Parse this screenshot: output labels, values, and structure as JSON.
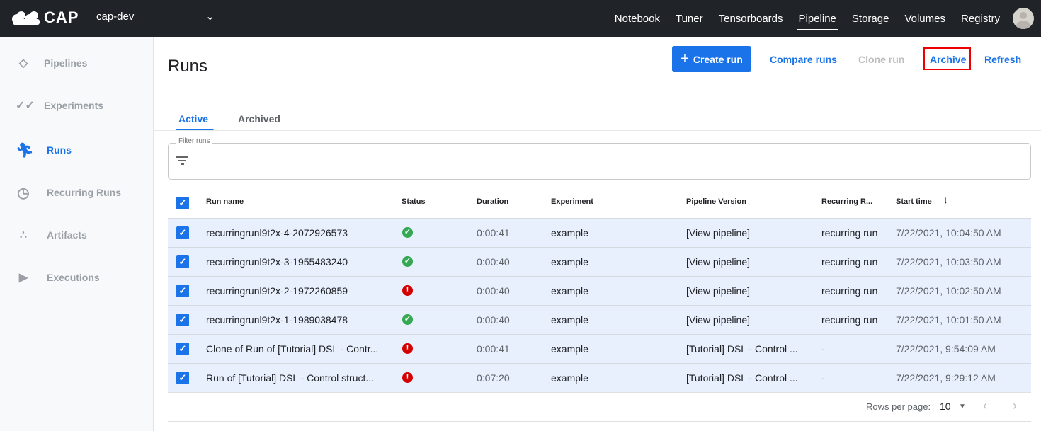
{
  "topbar": {
    "brand": "CAP",
    "namespace": "cap-dev",
    "nav": [
      "Notebook",
      "Tuner",
      "Tensorboards",
      "Pipeline",
      "Storage",
      "Volumes",
      "Registry"
    ],
    "active_nav": "Pipeline"
  },
  "sidebar": {
    "items": [
      {
        "label": "Pipelines",
        "icon": "pipelines-icon"
      },
      {
        "label": "Experiments",
        "icon": "experiments-icon"
      },
      {
        "label": "Runs",
        "icon": "runs-icon",
        "active": true
      },
      {
        "label": "Recurring Runs",
        "icon": "alarm-icon"
      },
      {
        "label": "Artifacts",
        "icon": "artifacts-icon"
      },
      {
        "label": "Executions",
        "icon": "play-icon"
      }
    ]
  },
  "page": {
    "title": "Runs",
    "create_run": "Create run",
    "compare_runs": "Compare runs",
    "clone_run": "Clone run",
    "archive": "Archive",
    "refresh": "Refresh"
  },
  "tabs": {
    "active": "Active",
    "archived": "Archived"
  },
  "filter": {
    "label": "Filter runs"
  },
  "table": {
    "headers": {
      "run_name": "Run name",
      "status": "Status",
      "duration": "Duration",
      "experiment": "Experiment",
      "pipeline_version": "Pipeline Version",
      "recurring_run": "Recurring R...",
      "start_time": "Start time"
    },
    "sort_indicator": "↓",
    "rows": [
      {
        "name": "recurringrunl9t2x-4-2072926573",
        "status": "success",
        "duration": "0:00:41",
        "experiment": "example",
        "pipeline": "[View pipeline]",
        "recurring": "recurring run",
        "start": "7/22/2021, 10:04:50 AM",
        "checked": true
      },
      {
        "name": "recurringrunl9t2x-3-1955483240",
        "status": "success",
        "duration": "0:00:40",
        "experiment": "example",
        "pipeline": "[View pipeline]",
        "recurring": "recurring run",
        "start": "7/22/2021, 10:03:50 AM",
        "checked": true
      },
      {
        "name": "recurringrunl9t2x-2-1972260859",
        "status": "error",
        "duration": "0:00:40",
        "experiment": "example",
        "pipeline": "[View pipeline]",
        "recurring": "recurring run",
        "start": "7/22/2021, 10:02:50 AM",
        "checked": true
      },
      {
        "name": "recurringrunl9t2x-1-1989038478",
        "status": "success",
        "duration": "0:00:40",
        "experiment": "example",
        "pipeline": "[View pipeline]",
        "recurring": "recurring run",
        "start": "7/22/2021, 10:01:50 AM",
        "checked": true
      },
      {
        "name": "Clone of Run of [Tutorial] DSL - Contr...",
        "status": "error",
        "duration": "0:00:41",
        "experiment": "example",
        "pipeline": "[Tutorial] DSL - Control ...",
        "recurring": "-",
        "start": "7/22/2021, 9:54:09 AM",
        "checked": true
      },
      {
        "name": "Run of [Tutorial] DSL - Control struct...",
        "status": "error",
        "duration": "0:07:20",
        "experiment": "example",
        "pipeline": "[Tutorial] DSL - Control ...",
        "recurring": "-",
        "start": "7/22/2021, 9:29:12 AM",
        "checked": true
      }
    ]
  },
  "pagination": {
    "rows_per_page_label": "Rows per page:",
    "rows_per_page": "10"
  },
  "colors": {
    "accent": "#1a73e8",
    "success": "#34a853",
    "error": "#d50000",
    "topbar": "#202328",
    "highlight": "#ee0000"
  }
}
